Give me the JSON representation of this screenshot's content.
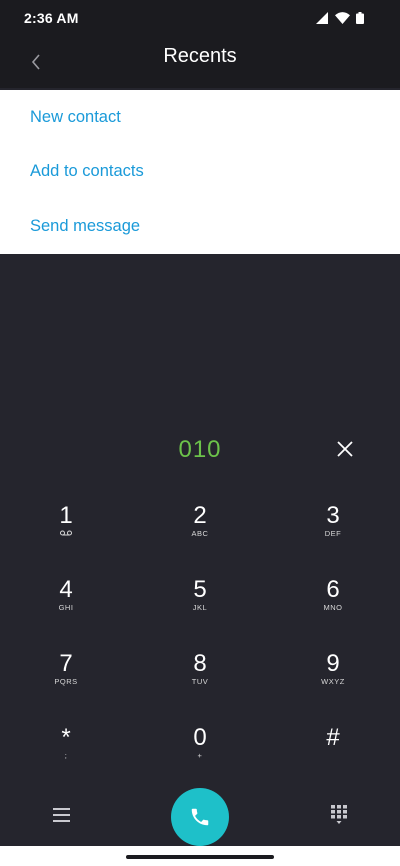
{
  "status_bar": {
    "time": "2:36 AM",
    "icons": [
      "signal-icon",
      "wifi-icon",
      "battery-icon"
    ]
  },
  "app_bar": {
    "title": "Recents",
    "back_icon": "chevron-left-icon"
  },
  "menu": {
    "items": [
      {
        "label": "New contact"
      },
      {
        "label": "Add to contacts"
      },
      {
        "label": "Send message"
      }
    ]
  },
  "dialer": {
    "number": "010",
    "clear_icon": "close-icon",
    "keys": [
      {
        "digit": "1",
        "sub": "voicemail-icon"
      },
      {
        "digit": "2",
        "sub": "ABC"
      },
      {
        "digit": "3",
        "sub": "DEF"
      },
      {
        "digit": "4",
        "sub": "GHI"
      },
      {
        "digit": "5",
        "sub": "JKL"
      },
      {
        "digit": "6",
        "sub": "MNO"
      },
      {
        "digit": "7",
        "sub": "PQRS"
      },
      {
        "digit": "8",
        "sub": "TUV"
      },
      {
        "digit": "9",
        "sub": "WXYZ"
      },
      {
        "digit": "*",
        "sub": ";"
      },
      {
        "digit": "0",
        "sub": "+"
      },
      {
        "digit": "#",
        "sub": ""
      }
    ]
  },
  "bottom_bar": {
    "menu_icon": "hamburger-menu-icon",
    "call_icon": "phone-icon",
    "dialpad_icon": "dialpad-icon"
  },
  "colors": {
    "accent_link": "#1a9ad9",
    "number_text": "#6cc24a",
    "call_button": "#1ec0c9",
    "background": "#25252d",
    "app_bar": "#1b1b1f"
  }
}
